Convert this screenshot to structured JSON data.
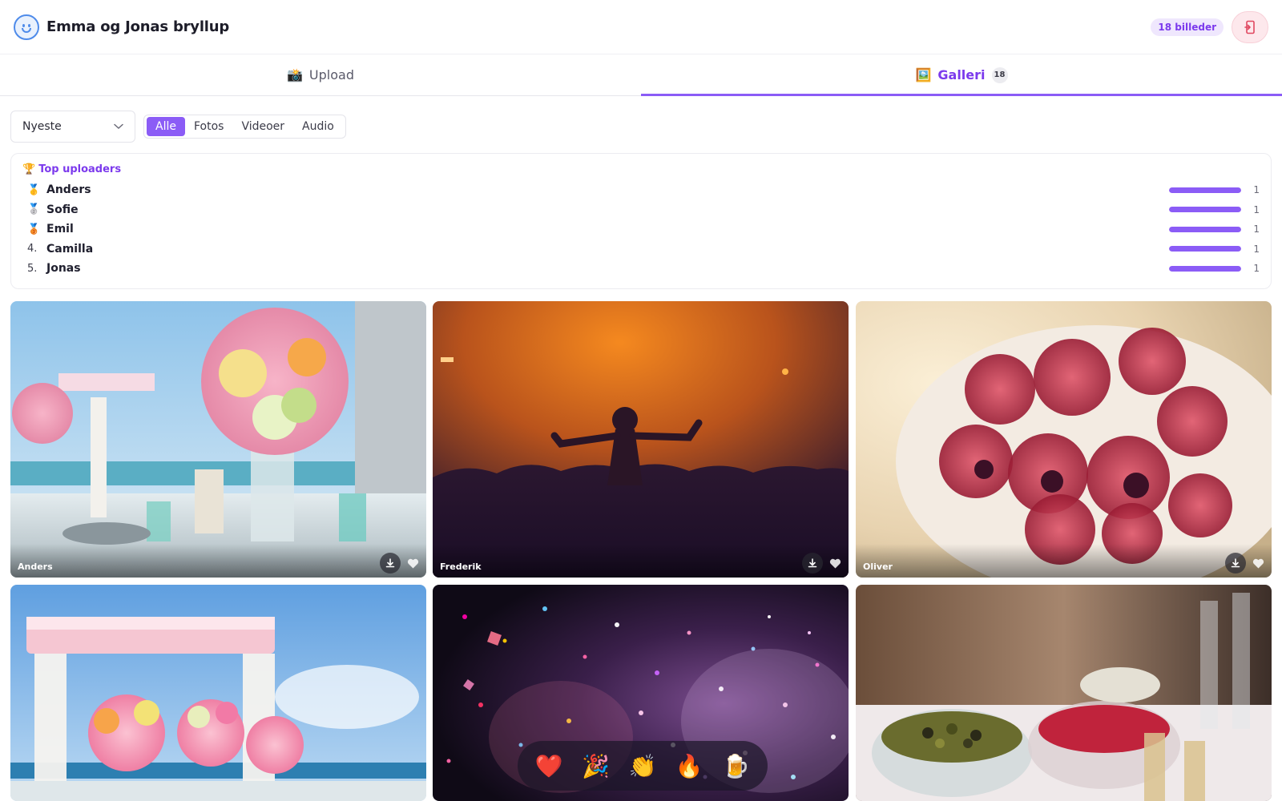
{
  "header": {
    "title": "Emma og Jonas bryllup",
    "count_badge": "18 billeder",
    "logo_icon": "smiley-logo-icon",
    "exit_icon": "exit-door-icon"
  },
  "tabs": [
    {
      "emoji": "📸",
      "label": "Upload"
    },
    {
      "emoji": "🖼️",
      "label": "Galleri",
      "count": "18"
    }
  ],
  "filters": {
    "sort_value": "Nyeste",
    "types": [
      "Alle",
      "Fotos",
      "Videoer",
      "Audio"
    ],
    "active_type": "Alle"
  },
  "leaderboard": {
    "icon": "🏆",
    "title": "Top uploaders",
    "rows": [
      {
        "rank": "🥇",
        "name": "Anders",
        "count": "1",
        "fill": 1.0
      },
      {
        "rank": "🥈",
        "name": "Sofie",
        "count": "1",
        "fill": 1.0
      },
      {
        "rank": "🥉",
        "name": "Emil",
        "count": "1",
        "fill": 1.0
      },
      {
        "rank": "4.",
        "name": "Camilla",
        "count": "1",
        "fill": 1.0
      },
      {
        "rank": "5.",
        "name": "Jonas",
        "count": "1",
        "fill": 1.0
      }
    ]
  },
  "gallery": [
    {
      "uploader": "Anders",
      "scene": "flower-table"
    },
    {
      "uploader": "Frederik",
      "scene": "concert"
    },
    {
      "uploader": "Oliver",
      "scene": "drinks"
    },
    {
      "uploader": "",
      "scene": "beach-canopy"
    },
    {
      "uploader": "",
      "scene": "confetti"
    },
    {
      "uploader": "",
      "scene": "buffet"
    }
  ],
  "reactions": [
    "❤️",
    "🎉",
    "👏",
    "🔥",
    "🍺"
  ],
  "colors": {
    "accent": "#8b5cf6",
    "accent_text": "#7c3aed",
    "exit_bg": "#fde8ec",
    "exit_icon": "#e0475f",
    "logo": "#4e8bea"
  }
}
